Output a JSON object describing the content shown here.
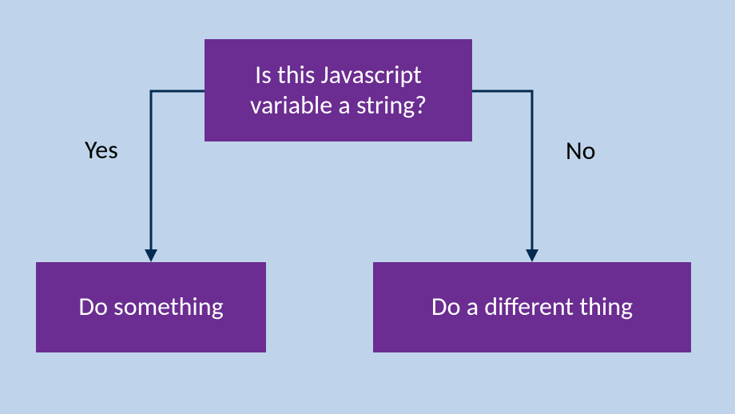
{
  "diagram": {
    "decision": "Is this Javascript variable a string?",
    "yes_label": "Yes",
    "no_label": "No",
    "yes_action": "Do something",
    "no_action": "Do a different thing"
  },
  "colors": {
    "background": "#bfd4eb",
    "box_fill": "#6b2d91",
    "box_text": "#ffffff",
    "connector": "#052c50",
    "label_text": "#000000"
  }
}
